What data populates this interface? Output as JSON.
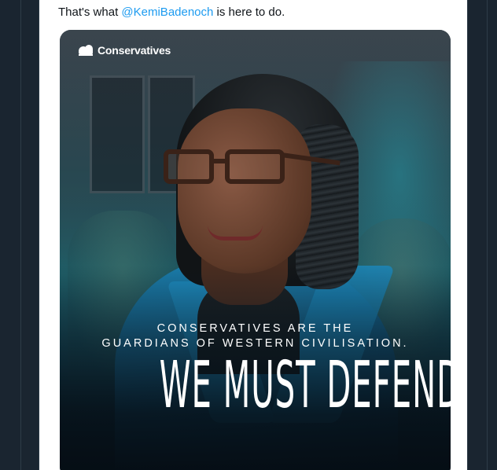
{
  "tweet": {
    "text_before": "That's what ",
    "mention": "@KemiBadenoch",
    "text_after": " is here to do."
  },
  "media": {
    "brand_name": "Conservatives",
    "subheading_line1": "CONSERVATIVES ARE THE",
    "subheading_line2": "GUARDIANS OF WESTERN CIVILISATION.",
    "headline": "WE MUST DEFEND IT.",
    "brand_icon": "tree-icon",
    "colors": {
      "jacket_blue": "#1a7fae",
      "background_teal": "#1f5d66",
      "mention_blue": "#1d9bf0"
    }
  }
}
